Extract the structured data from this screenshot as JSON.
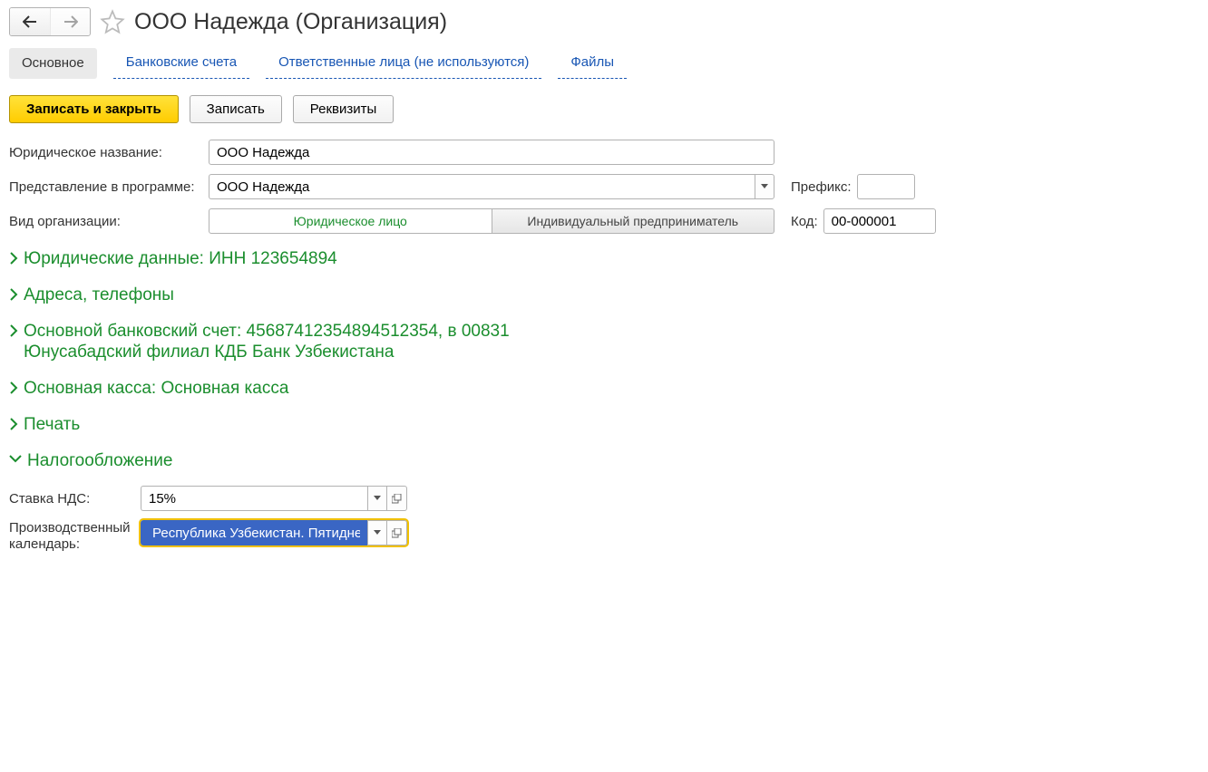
{
  "header": {
    "title": "ООО Надежда (Организация)"
  },
  "tabs": {
    "main": "Основное",
    "bank": "Банковские счета",
    "resp": "Ответственные лица (не используются)",
    "files": "Файлы"
  },
  "toolbar": {
    "save_close": "Записать и закрыть",
    "save": "Записать",
    "requisites": "Реквизиты"
  },
  "form": {
    "legal_name_label": "Юридическое название:",
    "legal_name_value": "ООО Надежда",
    "display_name_label": "Представление в программе:",
    "display_name_value": "ООО Надежда",
    "prefix_label": "Префикс:",
    "prefix_value": "",
    "org_type_label": "Вид организации:",
    "org_type_legal": "Юридическое лицо",
    "org_type_ip": "Индивидуальный предприниматель",
    "code_label": "Код:",
    "code_value": "00-000001"
  },
  "sections": {
    "legal_data": "Юридические данные: ИНН 123654894",
    "addresses": "Адреса, телефоны",
    "bank_account": "Основной банковский счет: 4568741235489451​2354, в 00831 Юнусабадский филиал КДБ Банк Узбекистана",
    "cash": "Основная касса: Основная касса",
    "print": "Печать",
    "tax": "Налогообложение"
  },
  "tax": {
    "vat_label": "Ставка НДС:",
    "vat_value": "15%",
    "calendar_label": "Производственный календарь:",
    "calendar_value": "Республика Узбекистан. Пятидне"
  }
}
